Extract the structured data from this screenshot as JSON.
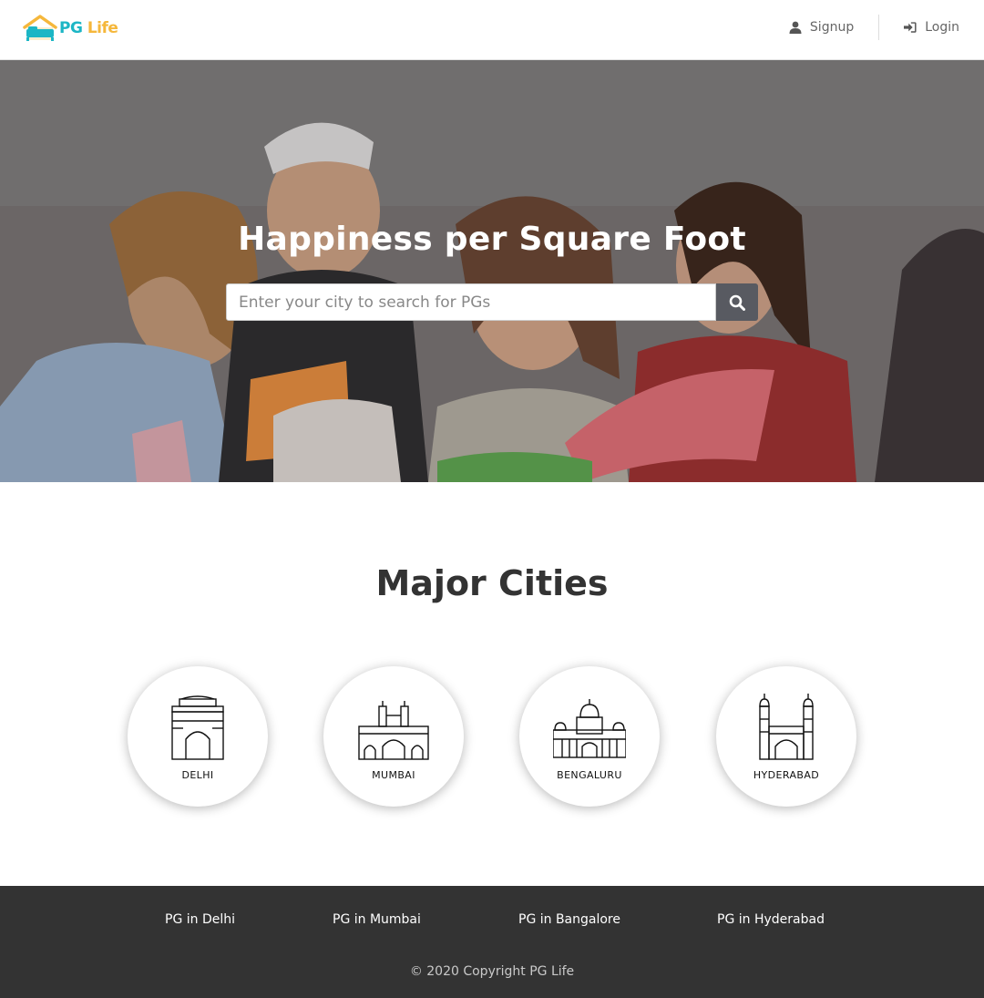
{
  "header": {
    "logo_pg": "PG",
    "logo_life": "Life",
    "signup_label": "Signup",
    "login_label": "Login"
  },
  "hero": {
    "title": "Happiness per Square Foot",
    "search_placeholder": "Enter your city to search for PGs",
    "search_value": ""
  },
  "cities_section": {
    "title": "Major Cities",
    "cities": [
      {
        "name": "DELHI",
        "icon": "india-gate-icon"
      },
      {
        "name": "MUMBAI",
        "icon": "gateway-of-india-icon"
      },
      {
        "name": "BENGALURU",
        "icon": "vidhana-soudha-icon"
      },
      {
        "name": "HYDERABAD",
        "icon": "charminar-icon"
      }
    ]
  },
  "footer": {
    "links": [
      "PG in Delhi",
      "PG in Mumbai",
      "PG in Bangalore",
      "PG in Hyderabad"
    ],
    "copyright": "© 2020 Copyright PG Life"
  },
  "colors": {
    "logo_teal": "#1cb6c5",
    "logo_yellow": "#f5b73b",
    "search_button": "#585a61",
    "footer_bg": "#333333"
  }
}
